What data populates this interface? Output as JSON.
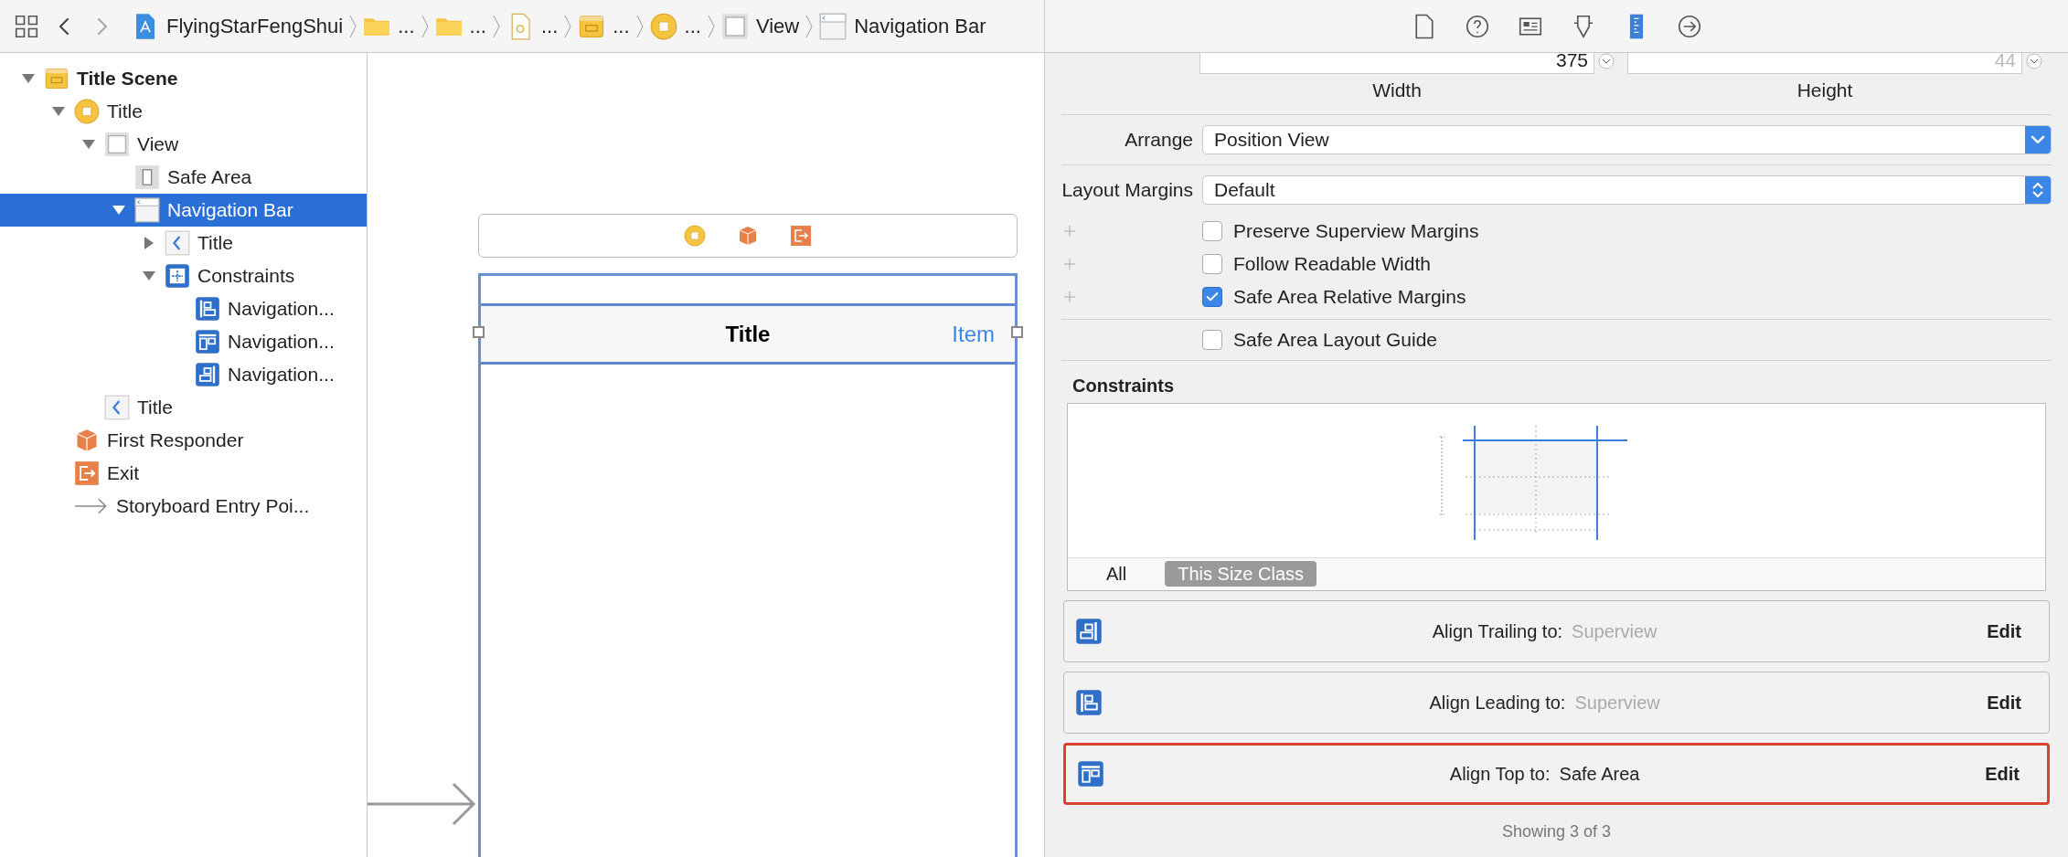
{
  "breadcrumb": [
    {
      "kind": "app",
      "label": "FlyingStarFengShui"
    },
    {
      "kind": "folder",
      "label": "..."
    },
    {
      "kind": "folder",
      "label": "..."
    },
    {
      "kind": "file",
      "label": "..."
    },
    {
      "kind": "scene",
      "label": "..."
    },
    {
      "kind": "controller",
      "label": "..."
    },
    {
      "kind": "view",
      "label": "View"
    },
    {
      "kind": "navbar",
      "label": "Navigation Bar"
    }
  ],
  "inspector_tabs": [
    {
      "kind": "file",
      "selected": false
    },
    {
      "kind": "help",
      "selected": false
    },
    {
      "kind": "identity",
      "selected": false
    },
    {
      "kind": "attributes",
      "selected": false
    },
    {
      "kind": "size",
      "selected": true
    },
    {
      "kind": "connections",
      "selected": false
    }
  ],
  "outline": [
    {
      "kind": "scene",
      "label": "Title Scene",
      "expanded": true,
      "selected": false,
      "children": [
        {
          "kind": "controller",
          "label": "Title",
          "expanded": true,
          "selected": false,
          "children": [
            {
              "kind": "view",
              "label": "View",
              "expanded": true,
              "selected": false,
              "children": [
                {
                  "kind": "safearea",
                  "label": "Safe Area",
                  "selected": false
                },
                {
                  "kind": "navbar",
                  "label": "Navigation Bar",
                  "expanded": true,
                  "selected": true,
                  "children": [
                    {
                      "kind": "navitem",
                      "label": "Title",
                      "expanded": false,
                      "selected": false
                    },
                    {
                      "kind": "constraints",
                      "label": "Constraints",
                      "expanded": true,
                      "selected": false,
                      "children": [
                        {
                          "kind": "leading",
                          "label": "Navigation...",
                          "selected": false
                        },
                        {
                          "kind": "top",
                          "label": "Navigation...",
                          "selected": false
                        },
                        {
                          "kind": "trailing",
                          "label": "Navigation...",
                          "selected": false
                        }
                      ]
                    }
                  ]
                }
              ]
            },
            {
              "kind": "navitem",
              "label": "Title",
              "selected": false
            }
          ]
        },
        {
          "kind": "responder",
          "label": "First Responder",
          "selected": false
        },
        {
          "kind": "exit",
          "label": "Exit",
          "selected": false
        },
        {
          "kind": "entry",
          "label": "Storyboard Entry Poi...",
          "selected": false
        }
      ]
    }
  ],
  "canvas": {
    "dock": [
      {
        "kind": "controller"
      },
      {
        "kind": "responder"
      },
      {
        "kind": "exit"
      }
    ],
    "nav_title": "Title",
    "nav_item": "Item"
  },
  "size": {
    "width": {
      "value": "375",
      "label": "Width",
      "disabled": false
    },
    "height": {
      "value": "44",
      "label": "Height",
      "disabled": true
    }
  },
  "arrange": {
    "label": "Arrange",
    "value": "Position View"
  },
  "layout_margins": {
    "label": "Layout Margins",
    "value": "Default"
  },
  "margin_options": [
    {
      "label": "Preserve Superview Margins",
      "checked": false
    },
    {
      "label": "Follow Readable Width",
      "checked": false
    },
    {
      "label": "Safe Area Relative Margins",
      "checked": true
    }
  ],
  "safe_area_guide": {
    "label": "Safe Area Layout Guide",
    "checked": false
  },
  "constraints": {
    "title": "Constraints",
    "filters": [
      {
        "label": "All",
        "selected": false
      },
      {
        "label": "This Size Class",
        "selected": true
      }
    ],
    "items": [
      {
        "kind": "trailing",
        "label": "Align Trailing to:",
        "target": "Superview",
        "dimmed": true,
        "highlighted": false,
        "action": "Edit"
      },
      {
        "kind": "leading",
        "label": "Align Leading to:",
        "target": "Superview",
        "dimmed": true,
        "highlighted": false,
        "action": "Edit"
      },
      {
        "kind": "top",
        "label": "Align Top to:",
        "target": "Safe Area",
        "dimmed": false,
        "highlighted": true,
        "action": "Edit"
      }
    ],
    "footer": "Showing 3 of 3"
  }
}
